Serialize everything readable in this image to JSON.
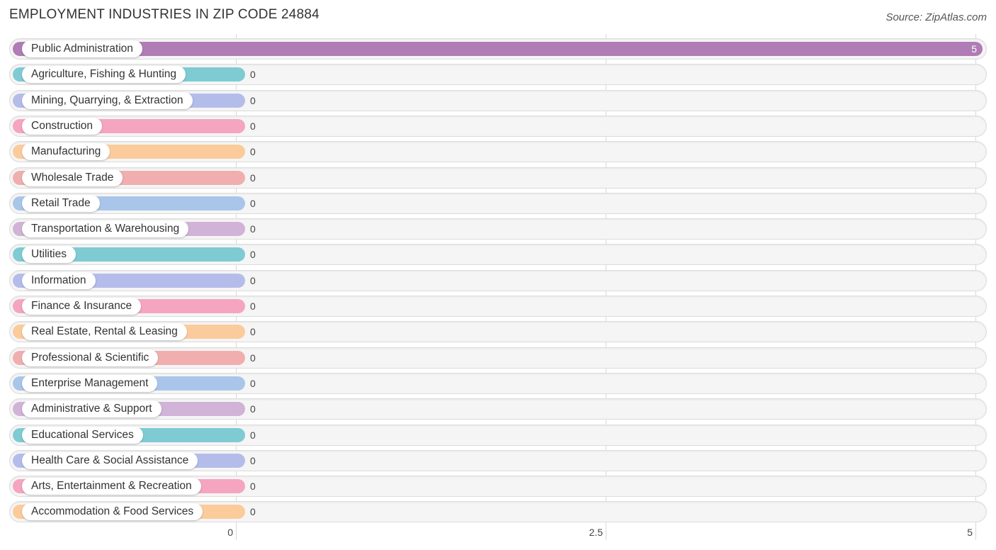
{
  "header": {
    "title": "EMPLOYMENT INDUSTRIES IN ZIP CODE 24884",
    "source": "Source: ZipAtlas.com"
  },
  "chart_data": {
    "type": "bar",
    "orientation": "horizontal",
    "title": "EMPLOYMENT INDUSTRIES IN ZIP CODE 24884",
    "xlabel": "",
    "ylabel": "",
    "xlim": [
      0,
      5
    ],
    "ticks": [
      0,
      2.5,
      5
    ],
    "tick_labels": [
      "0",
      "2.5",
      "5"
    ],
    "grid": true,
    "categories": [
      "Public Administration",
      "Agriculture, Fishing & Hunting",
      "Mining, Quarrying, & Extraction",
      "Construction",
      "Manufacturing",
      "Wholesale Trade",
      "Retail Trade",
      "Transportation & Warehousing",
      "Utilities",
      "Information",
      "Finance & Insurance",
      "Real Estate, Rental & Leasing",
      "Professional & Scientific",
      "Enterprise Management",
      "Administrative & Support",
      "Educational Services",
      "Health Care & Social Assistance",
      "Arts, Entertainment & Recreation",
      "Accommodation & Food Services"
    ],
    "values": [
      5,
      0,
      0,
      0,
      0,
      0,
      0,
      0,
      0,
      0,
      0,
      0,
      0,
      0,
      0,
      0,
      0,
      0,
      0
    ],
    "value_labels": [
      "5",
      "0",
      "0",
      "0",
      "0",
      "0",
      "0",
      "0",
      "0",
      "0",
      "0",
      "0",
      "0",
      "0",
      "0",
      "0",
      "0",
      "0",
      "0"
    ],
    "colors": [
      "#b07cb5",
      "#7ecbd3",
      "#b4bdea",
      "#f5a5c0",
      "#fbcb9b",
      "#f0afae",
      "#a9c6ea",
      "#d0b3d6",
      "#7ecbd3",
      "#b4bdea",
      "#f5a5c0",
      "#fbcb9b",
      "#f0afae",
      "#a9c6ea",
      "#d0b3d6",
      "#7ecbd3",
      "#b4bdea",
      "#f5a5c0",
      "#fbcb9b"
    ],
    "source": "Source: ZipAtlas.com"
  }
}
